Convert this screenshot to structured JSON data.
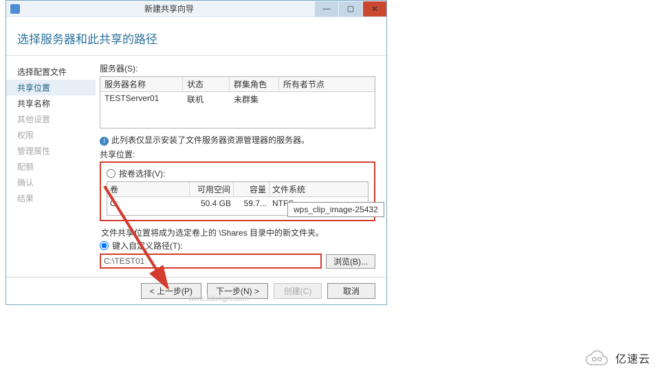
{
  "window": {
    "title": "新建共享向导",
    "minimize_glyph": "—",
    "maximize_glyph": "▢",
    "close_glyph": "✕"
  },
  "header": "选择服务器和此共享的路径",
  "sidebar": {
    "items": [
      {
        "label": "选择配置文件",
        "state": "enabled"
      },
      {
        "label": "共享位置",
        "state": "active"
      },
      {
        "label": "共享名称",
        "state": "enabled"
      },
      {
        "label": "其他设置",
        "state": "disabled"
      },
      {
        "label": "权限",
        "state": "disabled"
      },
      {
        "label": "管理属性",
        "state": "disabled"
      },
      {
        "label": "配额",
        "state": "disabled"
      },
      {
        "label": "确认",
        "state": "disabled"
      },
      {
        "label": "结果",
        "state": "disabled"
      }
    ]
  },
  "servers": {
    "label": "服务器(S):",
    "columns": [
      "服务器名称",
      "状态",
      "群集角色",
      "所有者节点"
    ],
    "rows": [
      {
        "name": "TESTServer01",
        "status": "联机",
        "cluster": "未群集",
        "owner": ""
      }
    ],
    "info_text": "此列表仅显示安装了文件服务器资源管理器的服务器。"
  },
  "share_location": {
    "section_label": "共享位置:",
    "by_volume_label": "按卷选择(V):",
    "volume_columns": [
      "卷",
      "可用空间",
      "容量",
      "文件系统"
    ],
    "volume_rows": [
      {
        "vol": "C:",
        "free": "50.4 GB",
        "cap": "59.7...",
        "fs": "NTFS"
      }
    ],
    "note": "文件共享位置将成为选定卷上的 \\Shares 目录中的新文件夹。",
    "custom_path_label": "键入自定义路径(T):",
    "path_value": "C:\\TEST01",
    "browse_label": "浏览(B)..."
  },
  "buttons": {
    "prev": "< 上一步(P)",
    "next": "下一步(N) >",
    "create": "创建(C)",
    "cancel": "取消"
  },
  "tooltip": "wps_clip_image-25432",
  "watermark": "www.ildongni.com",
  "footer_logo": "亿速云"
}
